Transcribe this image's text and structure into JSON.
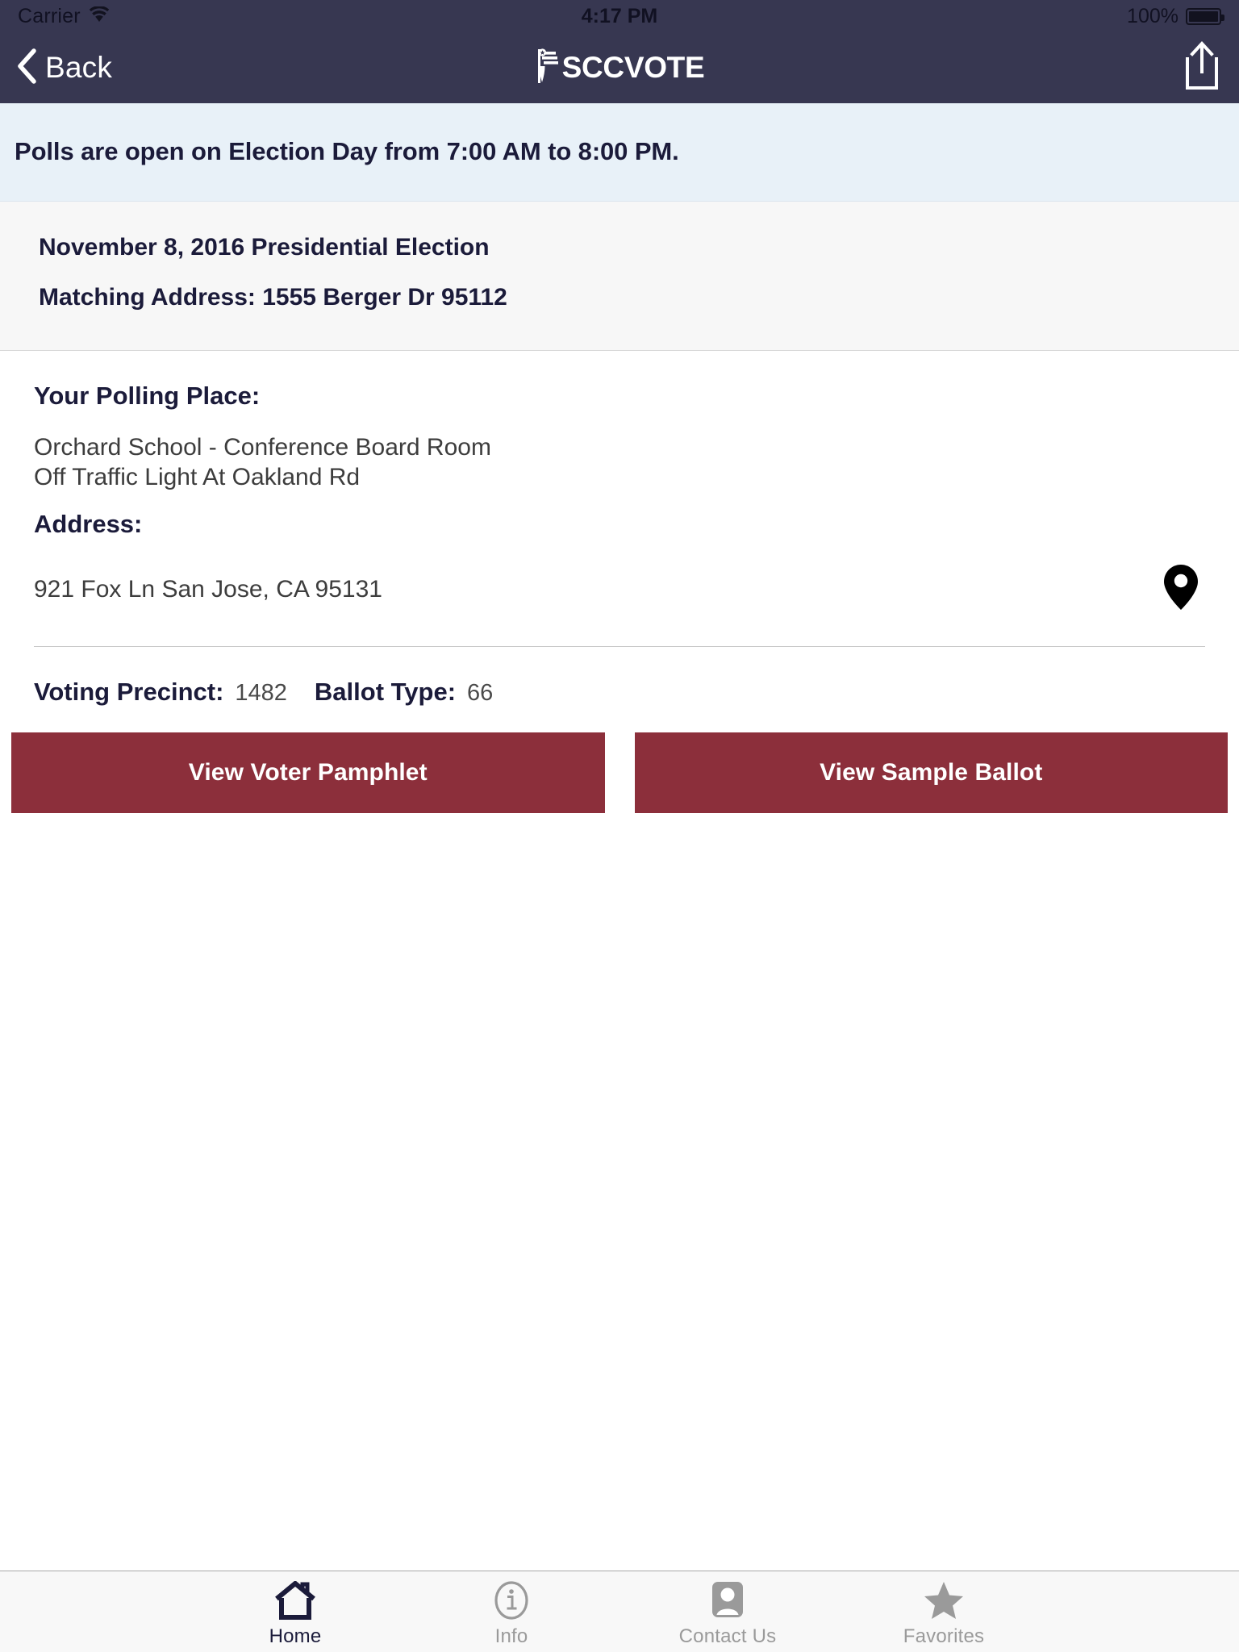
{
  "status_bar": {
    "carrier": "Carrier",
    "wifi_icon": "wifi-icon",
    "time": "4:17 PM",
    "battery_percent": "100%",
    "battery_icon": "battery-full-icon"
  },
  "nav": {
    "back_label": "Back",
    "back_icon": "chevron-left-icon",
    "title": "SCCVOTE",
    "brand_icon": "flag-icon",
    "share_icon": "share-icon"
  },
  "banner": {
    "text": "Polls are open on Election Day from 7:00 AM to 8:00 PM."
  },
  "election": {
    "name": "November 8, 2016 Presidential Election",
    "matching_address": "Matching Address: 1555 Berger Dr 95112"
  },
  "polling_place": {
    "heading": "Your Polling Place:",
    "name": "Orchard School - Conference Board Room",
    "directions": "Off Traffic Light At Oakland Rd",
    "address_label": "Address:",
    "address": "921 Fox Ln San Jose, CA 95131",
    "map_pin_icon": "map-pin-icon"
  },
  "precinct": {
    "precinct_label": "Voting Precinct:",
    "precinct_value": "1482",
    "ballot_type_label": "Ballot Type:",
    "ballot_type_value": "66"
  },
  "actions": {
    "voter_pamphlet": "View Voter Pamphlet",
    "sample_ballot": "View Sample Ballot",
    "button_color": "#8c2f3b"
  },
  "tabs": [
    {
      "label": "Home",
      "icon": "home-icon",
      "active": true
    },
    {
      "label": "Info",
      "icon": "info-circle-icon",
      "active": false
    },
    {
      "label": "Contact Us",
      "icon": "contact-card-icon",
      "active": false
    },
    {
      "label": "Favorites",
      "icon": "star-icon",
      "active": false
    }
  ],
  "colors": {
    "nav_background": "#373751",
    "banner_background": "#e8f1f8",
    "text_dark": "#1b1b3a",
    "accent_red": "#8c2f3b"
  }
}
